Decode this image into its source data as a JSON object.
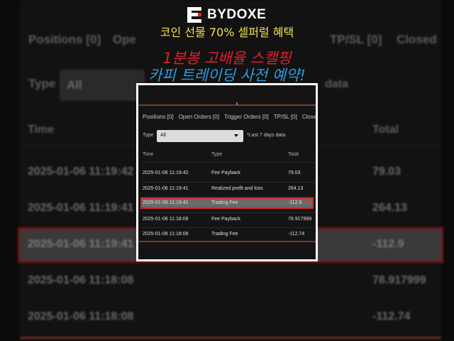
{
  "brand": {
    "name": "BYDOXE"
  },
  "promo": {
    "line1": "코인 선물 70% 셀퍼럴 혜택",
    "line2": "1분봉 고배율 스캘핑",
    "line3": "카피 트레이딩 사전 예약!"
  },
  "tabs": [
    "Positions [0]",
    "Open Orders [0]",
    "Trigger Orders [0]",
    "TP/SL [0]",
    "Closed"
  ],
  "background_tabs": [
    "Positions [0]",
    "Ope",
    "TP/SL [0]",
    "Closed"
  ],
  "filter": {
    "type_label": "Type",
    "type_value": "All",
    "note": "*Last 7 days data",
    "background_note": "data"
  },
  "columns": {
    "time": "Time",
    "type": "Type",
    "total": "Total"
  },
  "rows": [
    {
      "time": "2025-01-06 11:19:42",
      "type": "Fee Payback",
      "total": "79.03"
    },
    {
      "time": "2025-01-06 11:19:41",
      "type": "Realized profit and loss",
      "total": "264.13"
    },
    {
      "time": "2025-01-06 11:19:41",
      "type": "Trading Fee",
      "total": "-112.9",
      "highlighted": true
    },
    {
      "time": "2025-01-06 11:18:08",
      "type": "Fee Payback",
      "total": "78.917999"
    },
    {
      "time": "2025-01-06 11:18:08",
      "type": "Trading Fee",
      "total": "-112.74"
    }
  ],
  "colors": {
    "accent_red": "#d42a2a",
    "promo_yellow": "#f2e34a",
    "promo_red": "#e0202a",
    "promo_blue": "#2a9de0"
  }
}
